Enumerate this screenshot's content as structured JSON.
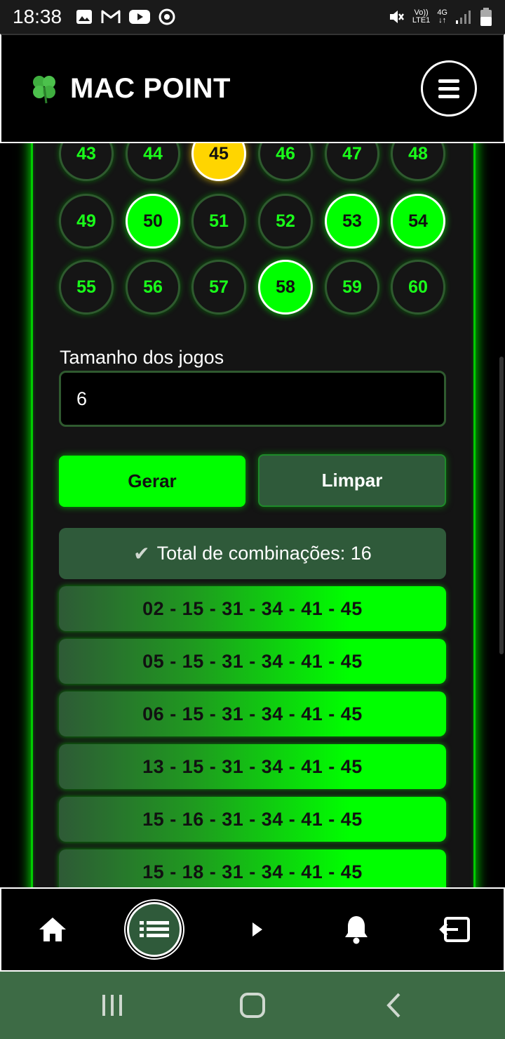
{
  "status_bar": {
    "time": "18:38",
    "network_top": "Vo))",
    "network_bottom": "LTE1",
    "signal_type": "4G"
  },
  "header": {
    "logo_icon": "four-leaf-clover",
    "title": "MAC POINT",
    "menu_icon": "hamburger-icon"
  },
  "numbers": {
    "rows": [
      [
        "43",
        "44",
        "45",
        "46",
        "47",
        "48"
      ],
      [
        "49",
        "50",
        "51",
        "52",
        "53",
        "54"
      ],
      [
        "55",
        "56",
        "57",
        "58",
        "59",
        "60"
      ]
    ],
    "selected": [
      "50",
      "53",
      "54",
      "58"
    ],
    "highlighted": [
      "45"
    ]
  },
  "form": {
    "size_label": "Tamanho dos jogos",
    "size_value": "6",
    "generate_label": "Gerar",
    "clear_label": "Limpar"
  },
  "result": {
    "total_text": "Total de combinações: 16",
    "combinations": [
      "02 - 15 - 31 - 34 - 41 - 45",
      "05 - 15 - 31 - 34 - 41 - 45",
      "06 - 15 - 31 - 34 - 41 - 45",
      "13 - 15 - 31 - 34 - 41 - 45",
      "15 - 16 - 31 - 34 - 41 - 45",
      "15 - 18 - 31 - 34 - 41 - 45"
    ]
  },
  "colors": {
    "accent": "#00ff00",
    "dark_green": "#2f5a3a",
    "highlight": "#ffd500",
    "system_nav": "#3d6b45"
  },
  "bottom_nav": {
    "items": [
      "home-icon",
      "list-icon",
      "play-icon",
      "bell-icon",
      "logout-icon"
    ],
    "active": "list-icon"
  }
}
